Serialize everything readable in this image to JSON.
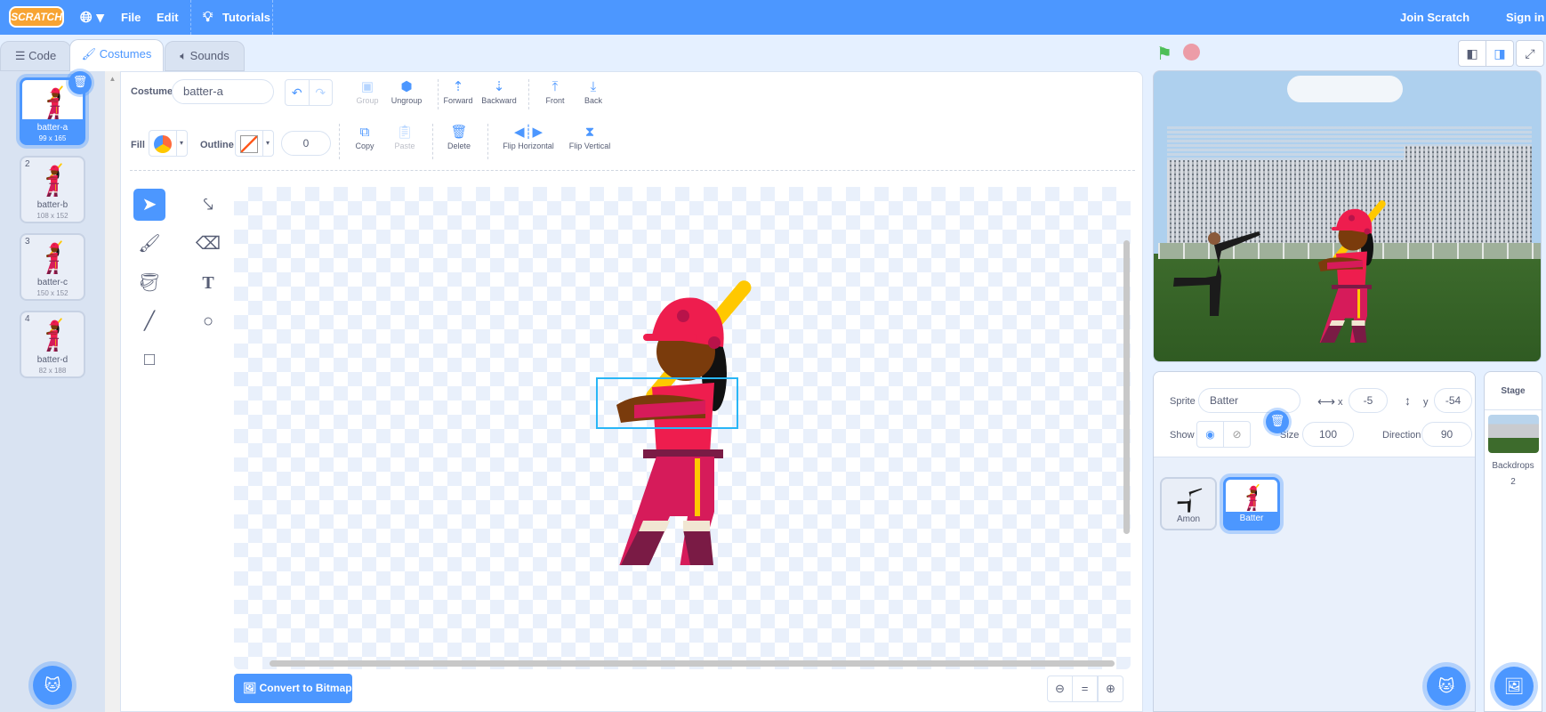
{
  "menubar": {
    "logo": "SCRATCH",
    "file": "File",
    "edit": "Edit",
    "tutorials": "Tutorials",
    "join": "Join Scratch",
    "sign_in": "Sign in"
  },
  "tabs": {
    "code": "Code",
    "costumes": "Costumes",
    "sounds": "Sounds"
  },
  "costumes": [
    {
      "num": "1",
      "name": "batter-a",
      "size": "99 x 165",
      "selected": true
    },
    {
      "num": "2",
      "name": "batter-b",
      "size": "108 x 152"
    },
    {
      "num": "3",
      "name": "batter-c",
      "size": "150 x 152"
    },
    {
      "num": "4",
      "name": "batter-d",
      "size": "82 x 188"
    }
  ],
  "toolbar": {
    "costume_label": "Costume",
    "costume_name": "batter-a",
    "group": "Group",
    "ungroup": "Ungroup",
    "forward": "Forward",
    "backward": "Backward",
    "front": "Front",
    "back": "Back",
    "fill_label": "Fill",
    "outline_label": "Outline",
    "outline_width": "0",
    "copy": "Copy",
    "paste": "Paste",
    "delete": "Delete",
    "flip_h": "Flip Horizontal",
    "flip_v": "Flip Vertical"
  },
  "editor": {
    "convert": "Convert to Bitmap",
    "zoom_reset": "="
  },
  "sprite": {
    "label": "Sprite",
    "name": "Batter",
    "x_label": "x",
    "x": "-5",
    "y_label": "y",
    "y": "-54",
    "show_label": "Show",
    "size_label": "Size",
    "size": "100",
    "direction_label": "Direction",
    "direction": "90"
  },
  "sprites": [
    {
      "name": "Amon"
    },
    {
      "name": "Batter",
      "selected": true
    }
  ],
  "stage_panel": {
    "title": "Stage",
    "backdrops_label": "Backdrops",
    "backdrops": "2"
  },
  "colors": {
    "accent": "#4c97ff",
    "menubar": "#4c97ff",
    "helmet": "#ee1d4e",
    "bat": "#ffc800"
  }
}
